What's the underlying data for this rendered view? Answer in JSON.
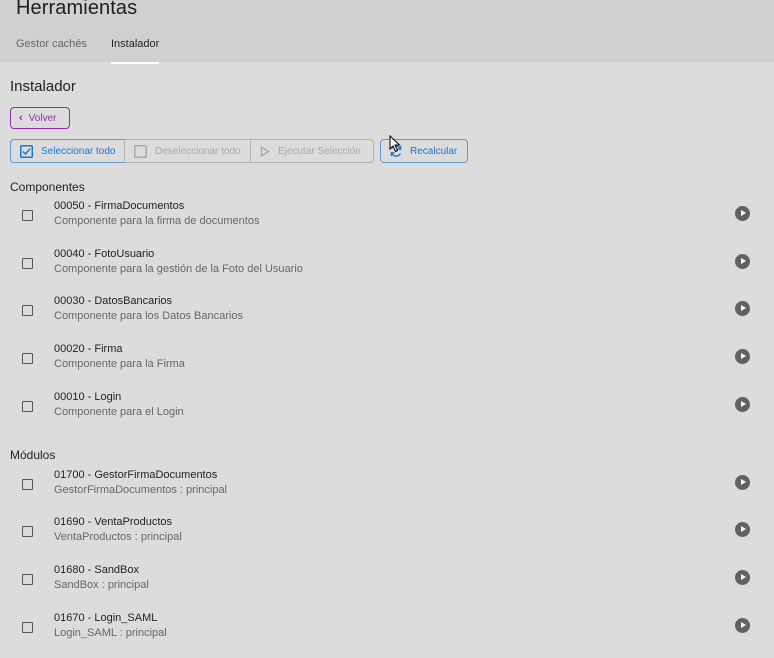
{
  "app": {
    "title": "Herramientas",
    "tabs": [
      {
        "label": "Gestor cachés",
        "active": false
      },
      {
        "label": "Instalador",
        "active": true
      }
    ]
  },
  "page": {
    "title": "Instalador",
    "back_label": "Volver"
  },
  "toolbar": {
    "select_all": "Seleccionar todo",
    "deselect_all": "Deseleccionar todo",
    "execute_selection": "Ejecutar Selección",
    "recalculate": "Recalcular"
  },
  "components": {
    "title": "Componentes",
    "items": [
      {
        "name": "00050 - FirmaDocumentos",
        "description": "Componente para la firma de documentos"
      },
      {
        "name": "00040 - FotoUsuario",
        "description": "Componente para la gestión de la Foto del Usuario"
      },
      {
        "name": "00030 - DatosBancarios",
        "description": "Componente para los Datos Bancarios"
      },
      {
        "name": "00020 - Firma",
        "description": "Componente para la Firma"
      },
      {
        "name": "00010 - Login",
        "description": "Componente para el Login"
      }
    ]
  },
  "modules": {
    "title": "Módulos",
    "items": [
      {
        "name": "01700 - GestorFirmaDocumentos",
        "description": "GestorFirmaDocumentos : principal"
      },
      {
        "name": "01690 - VentaProductos",
        "description": "VentaProductos : principal"
      },
      {
        "name": "01680 - SandBox",
        "description": "SandBox : principal"
      },
      {
        "name": "01670 - Login_SAML",
        "description": "Login_SAML : principal"
      }
    ]
  },
  "colors": {
    "accent_blue": "#1976d2",
    "accent_purple": "#9c27b0",
    "play_icon": "#616161"
  }
}
